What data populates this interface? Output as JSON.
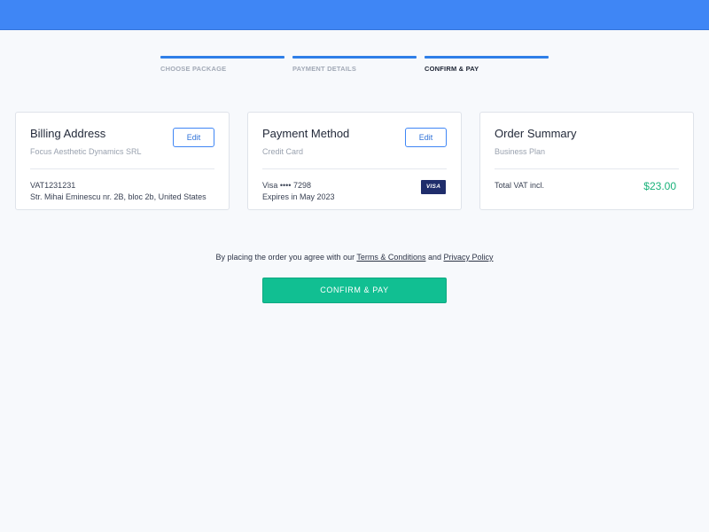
{
  "steps": [
    {
      "label": "CHOOSE PACKAGE"
    },
    {
      "label": "PAYMENT DETAILS"
    },
    {
      "label": "CONFIRM & PAY"
    }
  ],
  "billing": {
    "title": "Billing Address",
    "edit_label": "Edit",
    "company": "Focus Aesthetic Dynamics SRL",
    "vat": "VAT1231231",
    "address": "Str. Mihai Eminescu nr. 2B, bloc 2b, United States"
  },
  "payment": {
    "title": "Payment Method",
    "edit_label": "Edit",
    "type": "Credit Card",
    "card": "Visa •••• 7298",
    "expiry": "Expires in May 2023",
    "card_brand": "VISA"
  },
  "summary": {
    "title": "Order Summary",
    "plan": "Business Plan",
    "total_label": "Total VAT incl.",
    "total_amount": "$23.00"
  },
  "agreement": {
    "prefix": "By placing the order you agree with our ",
    "terms": "Terms & Conditions",
    "and": " and ",
    "privacy": "Privacy Policy"
  },
  "confirm_label": "CONFIRM & PAY",
  "colors": {
    "brand": "#3f86f5",
    "success": "#11bf92",
    "amount": "#19b27a"
  }
}
